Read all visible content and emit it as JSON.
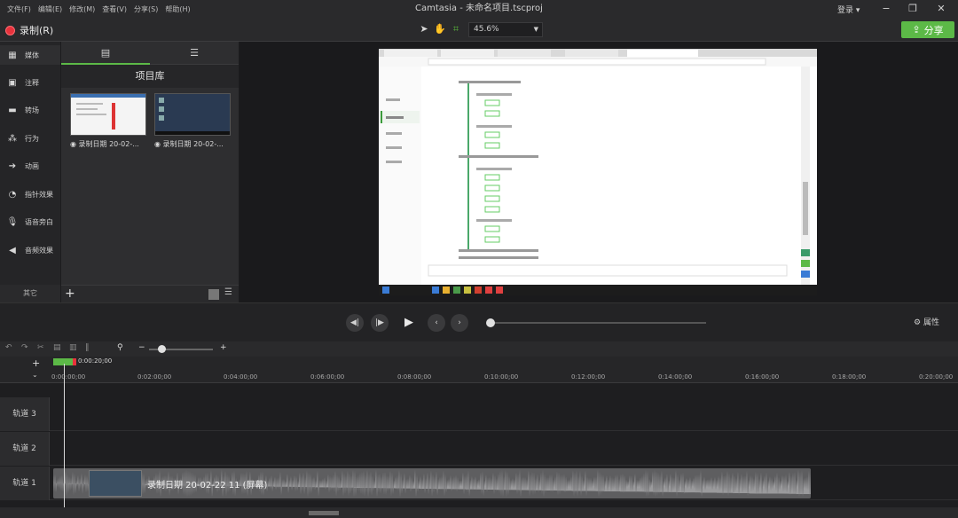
{
  "menu": [
    "文件(F)",
    "编辑(E)",
    "修改(M)",
    "查看(V)",
    "分享(S)",
    "帮助(H)"
  ],
  "window_title": "Camtasia - 未命名项目.tscproj",
  "login": "登录 ▾",
  "record_label": "录制(R)",
  "zoom_value": "45.6%",
  "share_label": "分享",
  "rail": [
    "媒体",
    "注释",
    "转场",
    "行为",
    "动画",
    "指针效果",
    "语音旁白",
    "音频效果"
  ],
  "rail_more": "其它",
  "media_tab_icons": [
    "film-icon",
    "list-icon"
  ],
  "library_title": "项目库",
  "clips": [
    "录制日期 20-02-...",
    "录制日期 20-02-..."
  ],
  "properties_label": "属性",
  "playhead_time": "0:00:20;00",
  "ruler_ticks": [
    "0:00:00;00",
    "0:02:00;00",
    "0:04:00;00",
    "0:06:00;00",
    "0:08:00;00",
    "0:10:00;00",
    "0:12:00;00",
    "0:14:00;00",
    "0:16:00;00",
    "0:18:00;00",
    "0:20:00;00"
  ],
  "tracks": [
    "轨道 3",
    "轨道 2",
    "轨道 1"
  ],
  "track1_clip": "录制日期 20-02-22 11 (屏幕)",
  "colors": {
    "accent": "#5cb947",
    "record": "#e8323c"
  }
}
